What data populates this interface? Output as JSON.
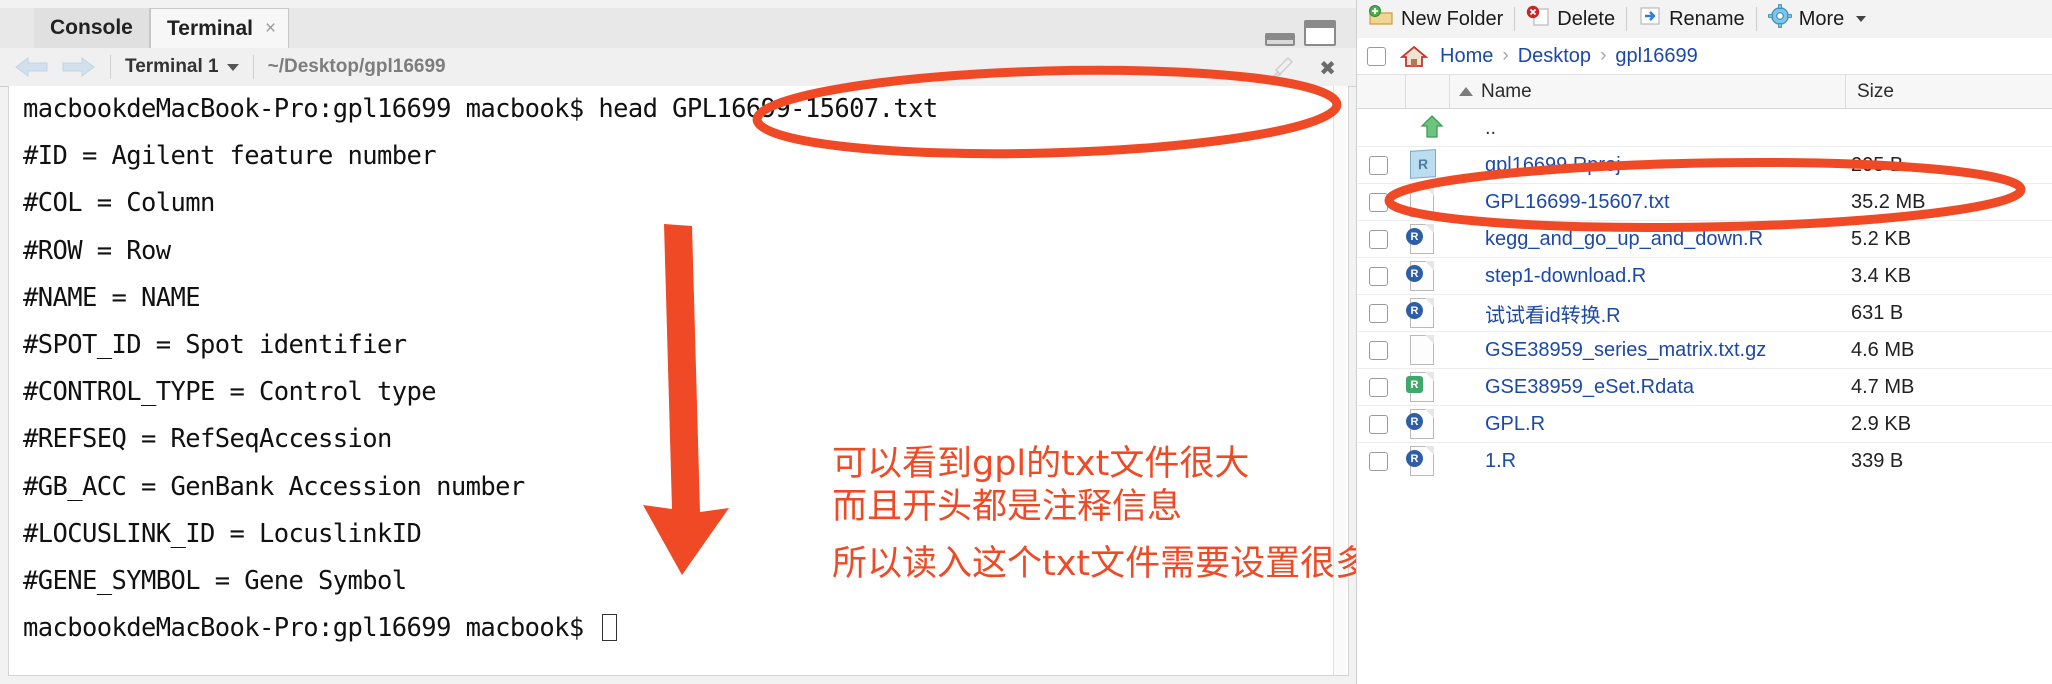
{
  "accent": {
    "annotation_orange": "#EF4A25",
    "link_blue": "#1C48A8",
    "terminal_text": "#111111"
  },
  "terminal_pane": {
    "tabs": [
      {
        "label": "Console",
        "active": false
      },
      {
        "label": "Terminal",
        "active": true,
        "close_icon": "close-icon",
        "close_glyph": "×"
      }
    ],
    "window_buttons": [
      {
        "name": "minimize-pane-button",
        "icon": "minimize-icon"
      },
      {
        "name": "maximize-pane-button",
        "icon": "maximize-icon"
      }
    ],
    "toolbar": {
      "back_icon": "back-arrow-icon",
      "forward_icon": "forward-arrow-icon",
      "terminal_select_label": "Terminal 1",
      "terminal_select_caret": "chevron-down-icon",
      "working_directory": "~/Desktop/gpl16699",
      "clear_icon": "broom-clear-icon",
      "close_icon": "close-icon",
      "close_glyph": "✖"
    },
    "lines": [
      "macbookdeMacBook-Pro:gpl16699 macbook$ head GPL16699-15607.txt",
      "#ID = Agilent feature number",
      "#COL = Column",
      "#ROW = Row",
      "#NAME = NAME",
      "#SPOT_ID = Spot identifier",
      "#CONTROL_TYPE = Control type",
      "#REFSEQ = RefSeqAccession",
      "#GB_ACC = GenBank Accession number",
      "#LOCUSLINK_ID = LocuslinkID",
      "#GENE_SYMBOL = Gene Symbol"
    ],
    "prompt_line": "macbookdeMacBook-Pro:gpl16699 macbook$ ",
    "cursor": "block-cursor"
  },
  "annotations": {
    "chinese_lines": [
      "可以看到gpl的txt文件很大",
      "而且开头都是注释信息",
      "所以读入这个txt文件需要设置很多参数"
    ],
    "shapes": [
      {
        "name": "ellipse-head-command",
        "type": "ellipse"
      },
      {
        "name": "ellipse-gpl-txt-file-row",
        "type": "ellipse"
      },
      {
        "name": "down-arrow-highlight",
        "type": "arrow"
      }
    ]
  },
  "files_pane": {
    "toolbar": [
      {
        "label": "New Folder",
        "icon": "new-folder-icon"
      },
      {
        "label": "Delete",
        "icon": "delete-icon"
      },
      {
        "label": "Rename",
        "icon": "rename-icon"
      },
      {
        "label": "More",
        "icon": "gear-icon",
        "caret": "chevron-down-icon"
      }
    ],
    "breadcrumb": {
      "home_icon": "home-icon",
      "separator": "›",
      "items": [
        "Home",
        "Desktop",
        "gpl16699"
      ]
    },
    "columns": [
      {
        "label": "Name",
        "sort": "ascending",
        "sort_icon": "sort-asc-icon"
      },
      {
        "label": "Size"
      }
    ],
    "rows": [
      {
        "name": "..",
        "size": "",
        "icon": "up-folder-arrow-icon",
        "checkbox": false,
        "link": false
      },
      {
        "name": "gpl16699.Rproj",
        "size": "205 B",
        "icon": "rproj-icon",
        "checkbox": true,
        "link": true
      },
      {
        "name": "GPL16699-15607.txt",
        "size": "35.2 MB",
        "icon": "text-file-icon",
        "checkbox": true,
        "link": true
      },
      {
        "name": "kegg_and_go_up_and_down.R",
        "size": "5.2 KB",
        "icon": "r-script-icon",
        "checkbox": true,
        "link": true
      },
      {
        "name": "step1-download.R",
        "size": "3.4 KB",
        "icon": "r-script-icon",
        "checkbox": true,
        "link": true
      },
      {
        "name": "试试看id转换.R",
        "size": "631 B",
        "icon": "r-script-icon",
        "checkbox": true,
        "link": true
      },
      {
        "name": "GSE38959_series_matrix.txt.gz",
        "size": "4.6 MB",
        "icon": "text-file-icon",
        "checkbox": true,
        "link": true
      },
      {
        "name": "GSE38959_eSet.Rdata",
        "size": "4.7 MB",
        "icon": "rdata-icon",
        "checkbox": true,
        "link": true
      },
      {
        "name": "GPL.R",
        "size": "2.9 KB",
        "icon": "r-script-icon",
        "checkbox": true,
        "link": true
      },
      {
        "name": "1.R",
        "size": "339 B",
        "icon": "r-script-icon",
        "checkbox": true,
        "link": true
      }
    ]
  }
}
